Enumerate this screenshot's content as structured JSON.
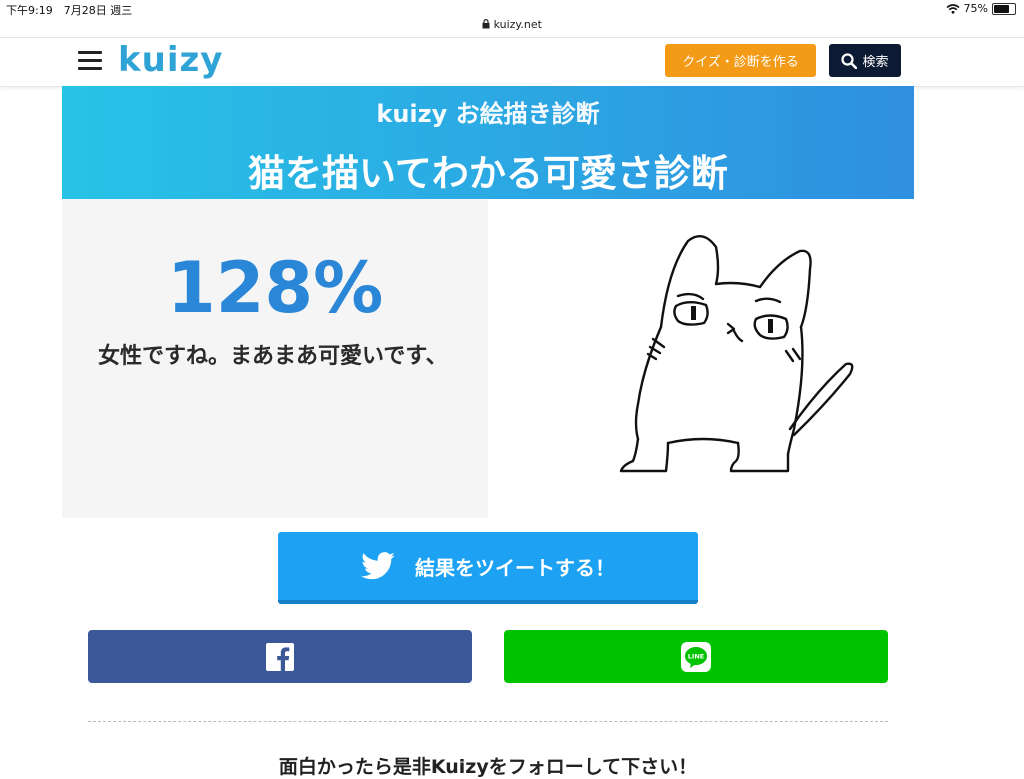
{
  "status_bar": {
    "time_date": "下午9:19　7月28日 週三",
    "battery": "75%",
    "battery_level": 0.75
  },
  "browser": {
    "url": "kuizy.net"
  },
  "header": {
    "logo": "kuizy",
    "create_button": "クイズ・診断を作る",
    "search_button": "検索"
  },
  "banner": {
    "subtitle": "kuizy お絵描き診断",
    "title": "猫を描いてわかる可愛さ診断"
  },
  "result": {
    "percent": "128%",
    "text": "女性ですね。まあまあ可愛いです、"
  },
  "share": {
    "tweet_label": "結果をツイートする！",
    "line_label": "LINE"
  },
  "follow_text": "面白かったら是非Kuizyをフォローして下さい！",
  "colors": {
    "brand": "#2fa3d6",
    "create": "#f39a16",
    "search": "#0d1a33",
    "twitter": "#1da1f2",
    "facebook": "#3b5998",
    "line": "#00c300",
    "percent": "#2a86d6"
  }
}
